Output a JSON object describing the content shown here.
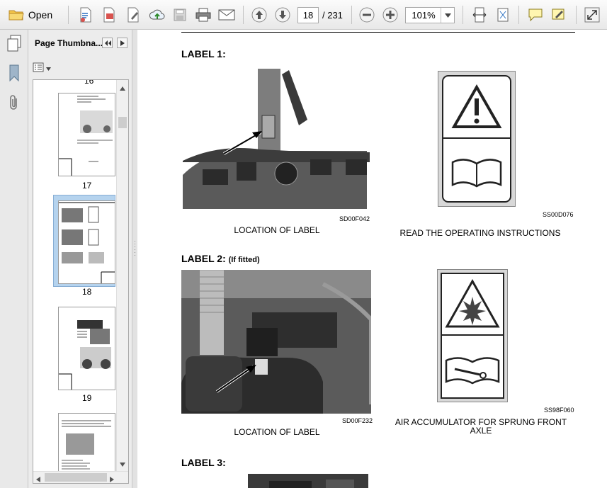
{
  "toolbar": {
    "open_label": "Open",
    "page_current": "18",
    "page_total": "/ 231",
    "zoom_value": "101%"
  },
  "panel": {
    "title": "Page Thumbna...",
    "thumbnails": [
      {
        "label": "16"
      },
      {
        "label": "17"
      },
      {
        "label": "18"
      },
      {
        "label": "19"
      }
    ]
  },
  "page": {
    "label1": {
      "title": "LABEL 1:",
      "photo_code": "SD00F042",
      "photo_caption": "LOCATION OF LABEL",
      "placard_code": "SS00D076",
      "placard_caption": "READ THE OPERATING INSTRUCTIONS"
    },
    "label2": {
      "title": "LABEL 2:",
      "title_note": "(If fitted)",
      "photo_code": "SD00F232",
      "photo_caption": "LOCATION OF LABEL",
      "placard_code": "SS98F060",
      "placard_caption_line1": "AIR ACCUMULATOR FOR SPRUNG FRONT",
      "placard_caption_line2": "AXLE"
    },
    "label3": {
      "title": "LABEL 3:"
    }
  },
  "icons": [
    "folder-icon",
    "create-pdf-icon",
    "edit-pdf-icon",
    "sign-icon",
    "upload-icon",
    "save-icon",
    "print-icon",
    "email-icon",
    "page-up-icon",
    "page-down-icon",
    "zoom-out-icon",
    "zoom-in-icon",
    "fit-width-icon",
    "fit-page-icon",
    "comment-icon",
    "sign-pen-icon",
    "expand-icon",
    "pages-icon",
    "bookmark-icon",
    "attachment-icon"
  ]
}
